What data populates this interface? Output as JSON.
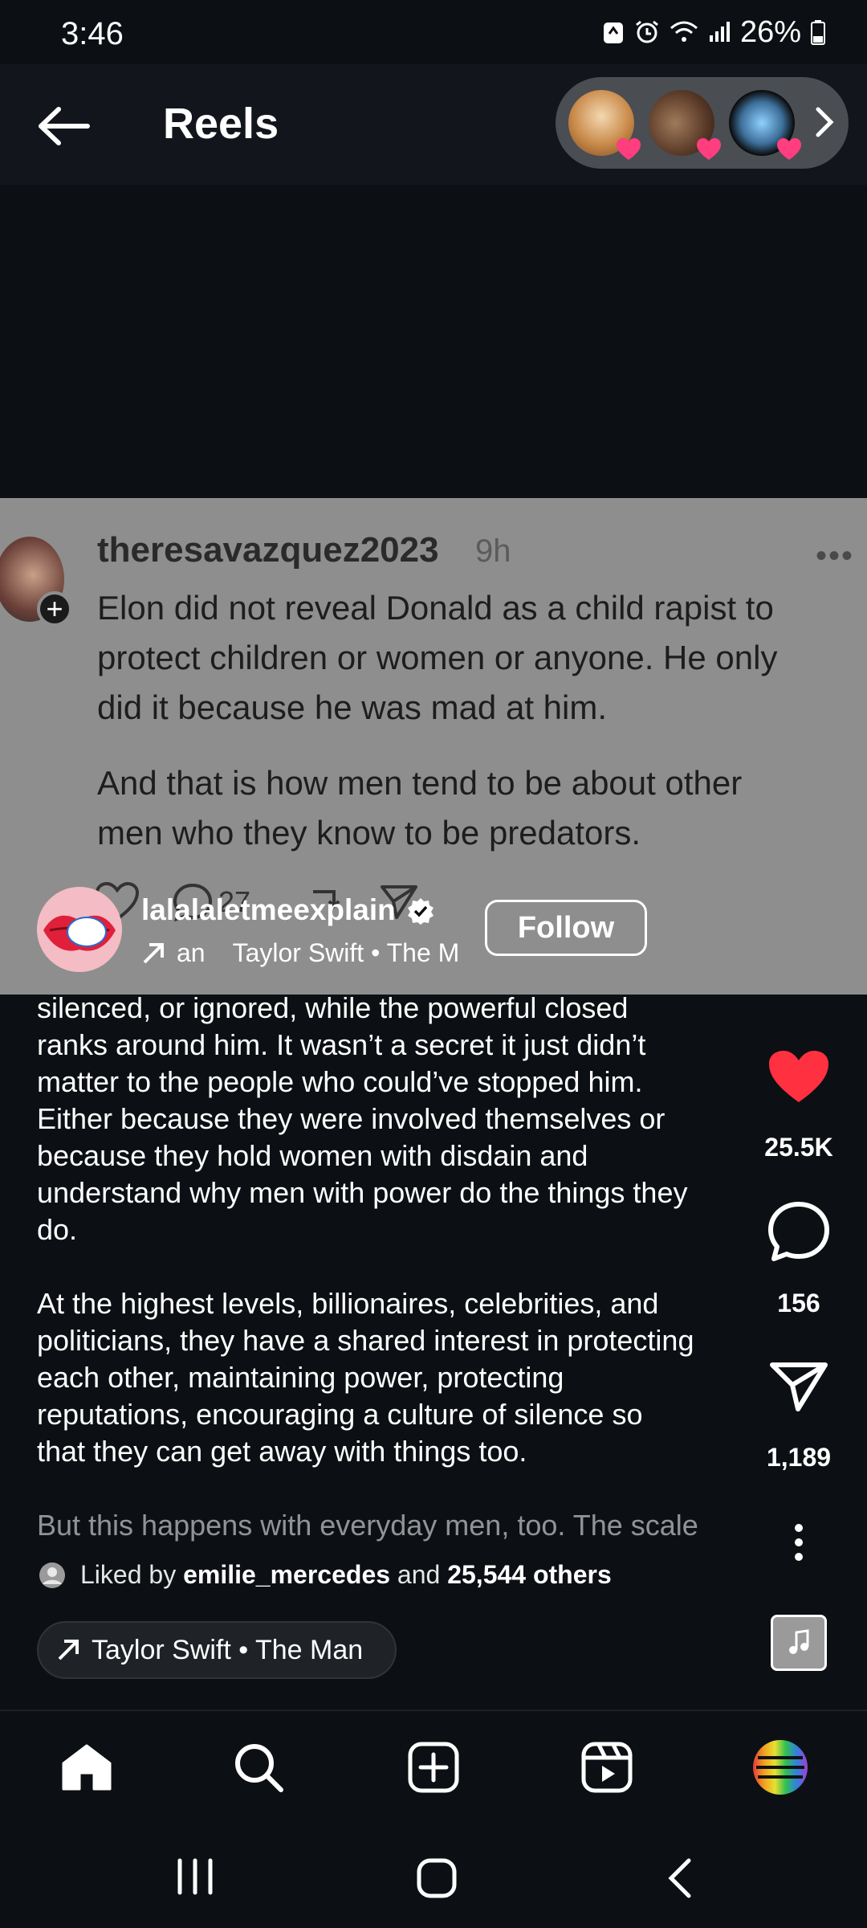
{
  "status_bar": {
    "time": "3:46",
    "battery": "26%"
  },
  "header": {
    "title": "Reels"
  },
  "stories": [
    {
      "name": "story-avatar-1",
      "color": "#c98a4a"
    },
    {
      "name": "story-avatar-2",
      "color": "#7a5a48"
    },
    {
      "name": "story-avatar-3",
      "color": "#3d6f9a"
    }
  ],
  "overlay_post": {
    "username": "theresavazquez2023",
    "time": "9h",
    "more": "•••",
    "paragraph1_lines": [
      "Elon did not reveal Donald as a child rapist to",
      "protect children or women or anyone. He only",
      "did it because he was mad at him."
    ],
    "paragraph2_lines": [
      "And that is how men tend to be about other",
      "men who they know to be predators."
    ],
    "comment_count": "27"
  },
  "author": {
    "username": "lalalaletmeexplain",
    "audio_prefix": "an",
    "audio_text": "Taylor Swift • The M",
    "follow_label": "Follow"
  },
  "caption": {
    "block1": "silenced, or ignored, while the powerful closed\nranks around him. It wasn’t a secret it just didn’t\nmatter to the people who could’ve stopped him.\nEither because they were involved themselves or\nbecause they hold women with disdain and\nunderstand why men with power do the things they\ndo.",
    "block2": "At the highest levels, billionaires, celebrities, and\npoliticians, they have a shared interest in protecting\neach other, maintaining power, protecting\nreputations, encouraging a culture of silence so\nthat they can get away with things too.",
    "faded_line": "But this happens with everyday men, too. The scale"
  },
  "actions": {
    "likes": "25.5K",
    "comments": "156",
    "shares": "1,189"
  },
  "liked_by": {
    "prefix": "Liked by",
    "user": "emilie_mercedes",
    "middle": "and",
    "others": "25,544 others"
  },
  "audio": {
    "label": "Taylor Swift • The Man"
  },
  "colors": {
    "like": "#ff3040",
    "background": "#0c1014",
    "overlay": "#8e8e8e"
  }
}
